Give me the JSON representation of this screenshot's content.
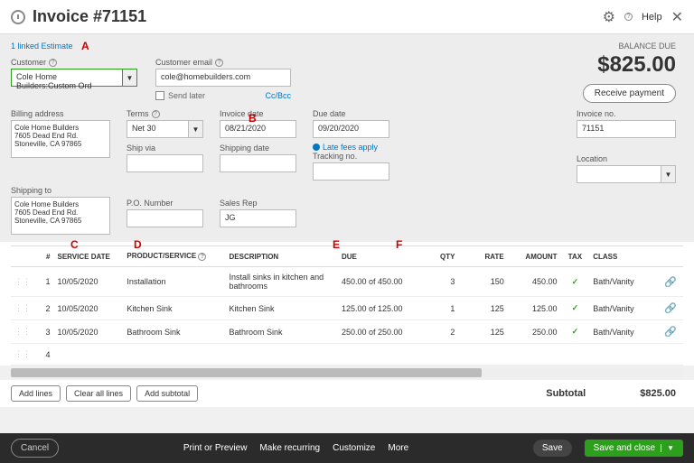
{
  "header": {
    "title": "Invoice #71151",
    "help": "Help"
  },
  "linked": "1 linked Estimate",
  "balance": {
    "label": "BALANCE DUE",
    "amount": "$825.00",
    "receive": "Receive payment"
  },
  "customer": {
    "label": "Customer",
    "value": "Cole Home Builders:Custom Ord",
    "email_label": "Customer email",
    "email_value": "cole@homebuilders.com",
    "ccbcc": "Cc/Bcc",
    "send_later": "Send later"
  },
  "billing": {
    "label": "Billing address",
    "value": "Cole Home Builders\n7605 Dead End Rd.\nStoneville, CA 97865"
  },
  "shipping": {
    "label": "Shipping to",
    "value": "Cole Home Builders\n7605 Dead End Rd.\nStoneville, CA 97865"
  },
  "terms": {
    "label": "Terms",
    "value": "Net 30"
  },
  "invoice_date": {
    "label": "Invoice date",
    "value": "08/21/2020"
  },
  "due_date": {
    "label": "Due date",
    "value": "09/20/2020",
    "late_fee": "Late fees apply"
  },
  "ship_via": {
    "label": "Ship via",
    "value": ""
  },
  "shipping_date": {
    "label": "Shipping date",
    "value": ""
  },
  "tracking": {
    "label": "Tracking no.",
    "value": ""
  },
  "invoice_no": {
    "label": "Invoice no.",
    "value": "71151"
  },
  "location": {
    "label": "Location",
    "value": ""
  },
  "po": {
    "label": "P.O. Number",
    "value": ""
  },
  "sales_rep": {
    "label": "Sales Rep",
    "value": "JG"
  },
  "annotations": {
    "a": "A",
    "b": "B",
    "c": "C",
    "d": "D",
    "e": "E",
    "f": "F"
  },
  "table": {
    "headers": {
      "num": "#",
      "date": "SERVICE DATE",
      "product": "PRODUCT/SERVICE",
      "desc": "DESCRIPTION",
      "due": "DUE",
      "qty": "QTY",
      "rate": "RATE",
      "amount": "AMOUNT",
      "tax": "TAX",
      "class": "CLASS"
    },
    "rows": [
      {
        "n": "1",
        "date": "10/05/2020",
        "product": "Installation",
        "desc": "Install sinks in kitchen and bathrooms",
        "due": "450.00 of 450.00",
        "qty": "3",
        "rate": "150",
        "amount": "450.00",
        "class": "Bath/Vanity"
      },
      {
        "n": "2",
        "date": "10/05/2020",
        "product": "Kitchen Sink",
        "desc": "Kitchen Sink",
        "due": "125.00 of 125.00",
        "qty": "1",
        "rate": "125",
        "amount": "125.00",
        "class": "Bath/Vanity"
      },
      {
        "n": "3",
        "date": "10/05/2020",
        "product": "Bathroom Sink",
        "desc": "Bathroom Sink",
        "due": "250.00 of 250.00",
        "qty": "2",
        "rate": "125",
        "amount": "250.00",
        "class": "Bath/Vanity"
      },
      {
        "n": "4",
        "date": "",
        "product": "",
        "desc": "",
        "due": "",
        "qty": "",
        "rate": "",
        "amount": "",
        "class": ""
      }
    ]
  },
  "buttons": {
    "add_lines": "Add lines",
    "clear_all": "Clear all lines",
    "add_subtotal": "Add subtotal"
  },
  "subtotal": {
    "label": "Subtotal",
    "value": "$825.00"
  },
  "footer": {
    "cancel": "Cancel",
    "print": "Print or Preview",
    "recurring": "Make recurring",
    "customize": "Customize",
    "more": "More",
    "save": "Save",
    "save_close": "Save and close"
  }
}
